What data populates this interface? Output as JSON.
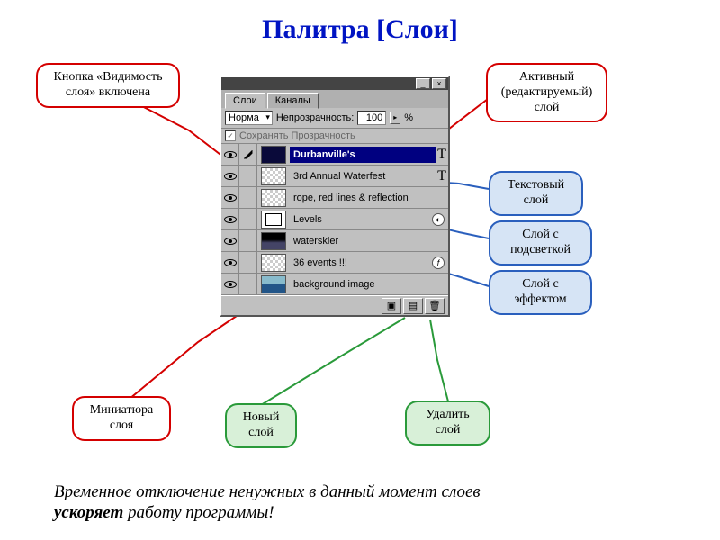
{
  "title": "Палитра [Слои]",
  "callouts": {
    "visibility": "Кнопка «Видимость слоя» включена",
    "active": "Активный (редактируемый) слой",
    "text_layer": "Текстовый слой",
    "highlight": "Слой с подсветкой",
    "effect": "Слой с эффектом",
    "thumbnail": "Миниатюра слоя",
    "new_layer": "Новый слой",
    "delete_layer": "Удалить слой"
  },
  "panel": {
    "tabs": {
      "layers": "Слои",
      "channels": "Каналы"
    },
    "blend_mode": "Норма",
    "opacity_label": "Непрозрачность:",
    "opacity_value": "100",
    "opacity_percent": "%",
    "preserve_label": "Сохранять Прозрачность"
  },
  "layers": [
    {
      "name": "Durbanville's",
      "active": true,
      "text": true,
      "thumb": "dark"
    },
    {
      "name": "3rd Annual Waterfest",
      "text": true,
      "thumb": "checker"
    },
    {
      "name": "rope, red lines & reflection",
      "thumb": "checker"
    },
    {
      "name": "Levels",
      "thumb": "levels",
      "fx": true
    },
    {
      "name": "waterskier",
      "thumb": "dark2"
    },
    {
      "name": "36 events !!!",
      "thumb": "checker",
      "fx": true
    },
    {
      "name": "background image",
      "thumb": "image"
    }
  ],
  "footer_line1": "Временное отключение ненужных в данный момент слоев",
  "footer_line2_strong": "ускоряет",
  "footer_line2_rest": " работу программы!",
  "t_glyph": "T"
}
